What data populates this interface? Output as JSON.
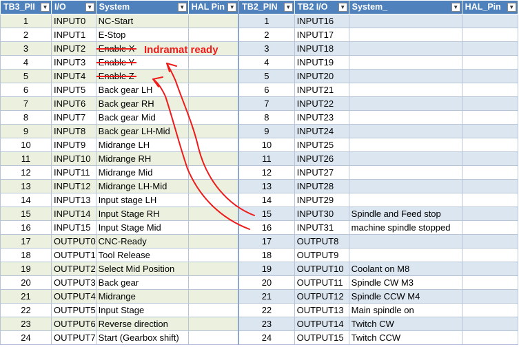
{
  "headers": [
    "TB3_PII",
    "I/O",
    "System",
    "HAL Pin",
    "TB2_PIN",
    "TB2 I/O",
    "System_",
    "HAL_Pin"
  ],
  "rows": [
    {
      "n": "1",
      "io": "INPUT0",
      "sys": "NC-Start",
      "hal": "",
      "n2": "1",
      "io2": "INPUT16",
      "sys2": "",
      "hal2": ""
    },
    {
      "n": "2",
      "io": "INPUT1",
      "sys": "E-Stop",
      "hal": "",
      "n2": "2",
      "io2": "INPUT17",
      "sys2": "",
      "hal2": ""
    },
    {
      "n": "3",
      "io": "INPUT2",
      "sys": "Enable X",
      "hal": "",
      "n2": "3",
      "io2": "INPUT18",
      "sys2": "",
      "hal2": ""
    },
    {
      "n": "4",
      "io": "INPUT3",
      "sys": "Enable Y",
      "hal": "",
      "n2": "4",
      "io2": "INPUT19",
      "sys2": "",
      "hal2": ""
    },
    {
      "n": "5",
      "io": "INPUT4",
      "sys": "Enable Z",
      "hal": "",
      "n2": "5",
      "io2": "INPUT20",
      "sys2": "",
      "hal2": ""
    },
    {
      "n": "6",
      "io": "INPUT5",
      "sys": "Back gear LH",
      "hal": "",
      "n2": "6",
      "io2": "INPUT21",
      "sys2": "",
      "hal2": ""
    },
    {
      "n": "7",
      "io": "INPUT6",
      "sys": "Back gear RH",
      "hal": "",
      "n2": "7",
      "io2": "INPUT22",
      "sys2": "",
      "hal2": ""
    },
    {
      "n": "8",
      "io": "INPUT7",
      "sys": "Back gear Mid",
      "hal": "",
      "n2": "8",
      "io2": "INPUT23",
      "sys2": "",
      "hal2": ""
    },
    {
      "n": "9",
      "io": "INPUT8",
      "sys": "Back gear LH-Mid",
      "hal": "",
      "n2": "9",
      "io2": "INPUT24",
      "sys2": "",
      "hal2": ""
    },
    {
      "n": "10",
      "io": "INPUT9",
      "sys": "Midrange LH",
      "hal": "",
      "n2": "10",
      "io2": "INPUT25",
      "sys2": "",
      "hal2": ""
    },
    {
      "n": "11",
      "io": "INPUT10",
      "sys": "Midrange RH",
      "hal": "",
      "n2": "11",
      "io2": "INPUT26",
      "sys2": "",
      "hal2": ""
    },
    {
      "n": "12",
      "io": "INPUT11",
      "sys": "Midrange Mid",
      "hal": "",
      "n2": "12",
      "io2": "INPUT27",
      "sys2": "",
      "hal2": ""
    },
    {
      "n": "13",
      "io": "INPUT12",
      "sys": "Midrange LH-Mid",
      "hal": "",
      "n2": "13",
      "io2": "INPUT28",
      "sys2": "",
      "hal2": ""
    },
    {
      "n": "14",
      "io": "INPUT13",
      "sys": "Input stage LH",
      "hal": "",
      "n2": "14",
      "io2": "INPUT29",
      "sys2": "",
      "hal2": ""
    },
    {
      "n": "15",
      "io": "INPUT14",
      "sys": "Input Stage RH",
      "hal": "",
      "n2": "15",
      "io2": "INPUT30",
      "sys2": "Spindle and Feed stop",
      "hal2": ""
    },
    {
      "n": "16",
      "io": "INPUT15",
      "sys": "Input Stage Mid",
      "hal": "",
      "n2": "16",
      "io2": "INPUT31",
      "sys2": "machine spindle stopped",
      "hal2": ""
    },
    {
      "n": "17",
      "io": "OUTPUT0",
      "sys": "CNC-Ready",
      "hal": "",
      "n2": "17",
      "io2": "OUTPUT8",
      "sys2": "",
      "hal2": ""
    },
    {
      "n": "18",
      "io": "OUTPUT1",
      "sys": "Tool Release",
      "hal": "",
      "n2": "18",
      "io2": "OUTPUT9",
      "sys2": "",
      "hal2": ""
    },
    {
      "n": "19",
      "io": "OUTPUT2",
      "sys": "Select Mid Position",
      "hal": "",
      "n2": "19",
      "io2": "OUTPUT10",
      "sys2": "Coolant on M8",
      "hal2": ""
    },
    {
      "n": "20",
      "io": "OUTPUT3",
      "sys": "Back gear",
      "hal": "",
      "n2": "20",
      "io2": "OUTPUT11",
      "sys2": "Spindle CW M3",
      "hal2": ""
    },
    {
      "n": "21",
      "io": "OUTPUT4",
      "sys": "Midrange",
      "hal": "",
      "n2": "21",
      "io2": "OUTPUT12",
      "sys2": "Spindle CCW M4",
      "hal2": ""
    },
    {
      "n": "22",
      "io": "OUTPUT5",
      "sys": "Input Stage",
      "hal": "",
      "n2": "22",
      "io2": "OUTPUT13",
      "sys2": "Main spindle on",
      "hal2": ""
    },
    {
      "n": "23",
      "io": "OUTPUT6",
      "sys": "Reverse direction",
      "hal": "",
      "n2": "23",
      "io2": "OUTPUT14",
      "sys2": "Twitch CW",
      "hal2": ""
    },
    {
      "n": "24",
      "io": "OUTPUT7",
      "sys": "Start (Gearbox shift)",
      "hal": "",
      "n2": "24",
      "io2": "OUTPUT15",
      "sys2": "Twitch CCW",
      "hal2": ""
    }
  ],
  "struck_rows": [
    2,
    3,
    4
  ],
  "annotation": "Indramat ready",
  "colors": {
    "header": "#4f81bd",
    "left_band": "#ebf1de",
    "right_band": "#dce6f1",
    "annotation": "#ee1b1b"
  },
  "icons": {
    "filter_dropdown": "chevron-down-icon"
  }
}
